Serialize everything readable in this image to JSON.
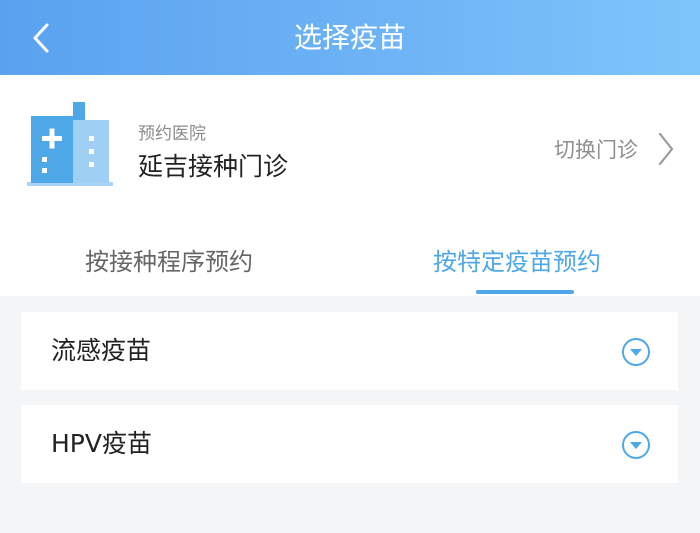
{
  "header": {
    "title": "选择疫苗",
    "back_icon": "chevron-left-icon"
  },
  "hospital": {
    "label": "预约医院",
    "name": "延吉接种门诊",
    "switch_label": "切换门诊",
    "icon": "hospital-building-icon"
  },
  "tabs": [
    {
      "label": "按接种程序预约",
      "active": false
    },
    {
      "label": "按特定疫苗预约",
      "active": true
    }
  ],
  "vaccines": [
    {
      "label": "流感疫苗",
      "icon": "chevron-down-circle-icon"
    },
    {
      "label": "HPV疫苗",
      "icon": "chevron-down-circle-icon"
    }
  ],
  "colors": {
    "header_gradient_start": "#5aa2f0",
    "header_gradient_end": "#7cc6fb",
    "accent": "#4ea7e6",
    "background": "#f4f5f7"
  }
}
